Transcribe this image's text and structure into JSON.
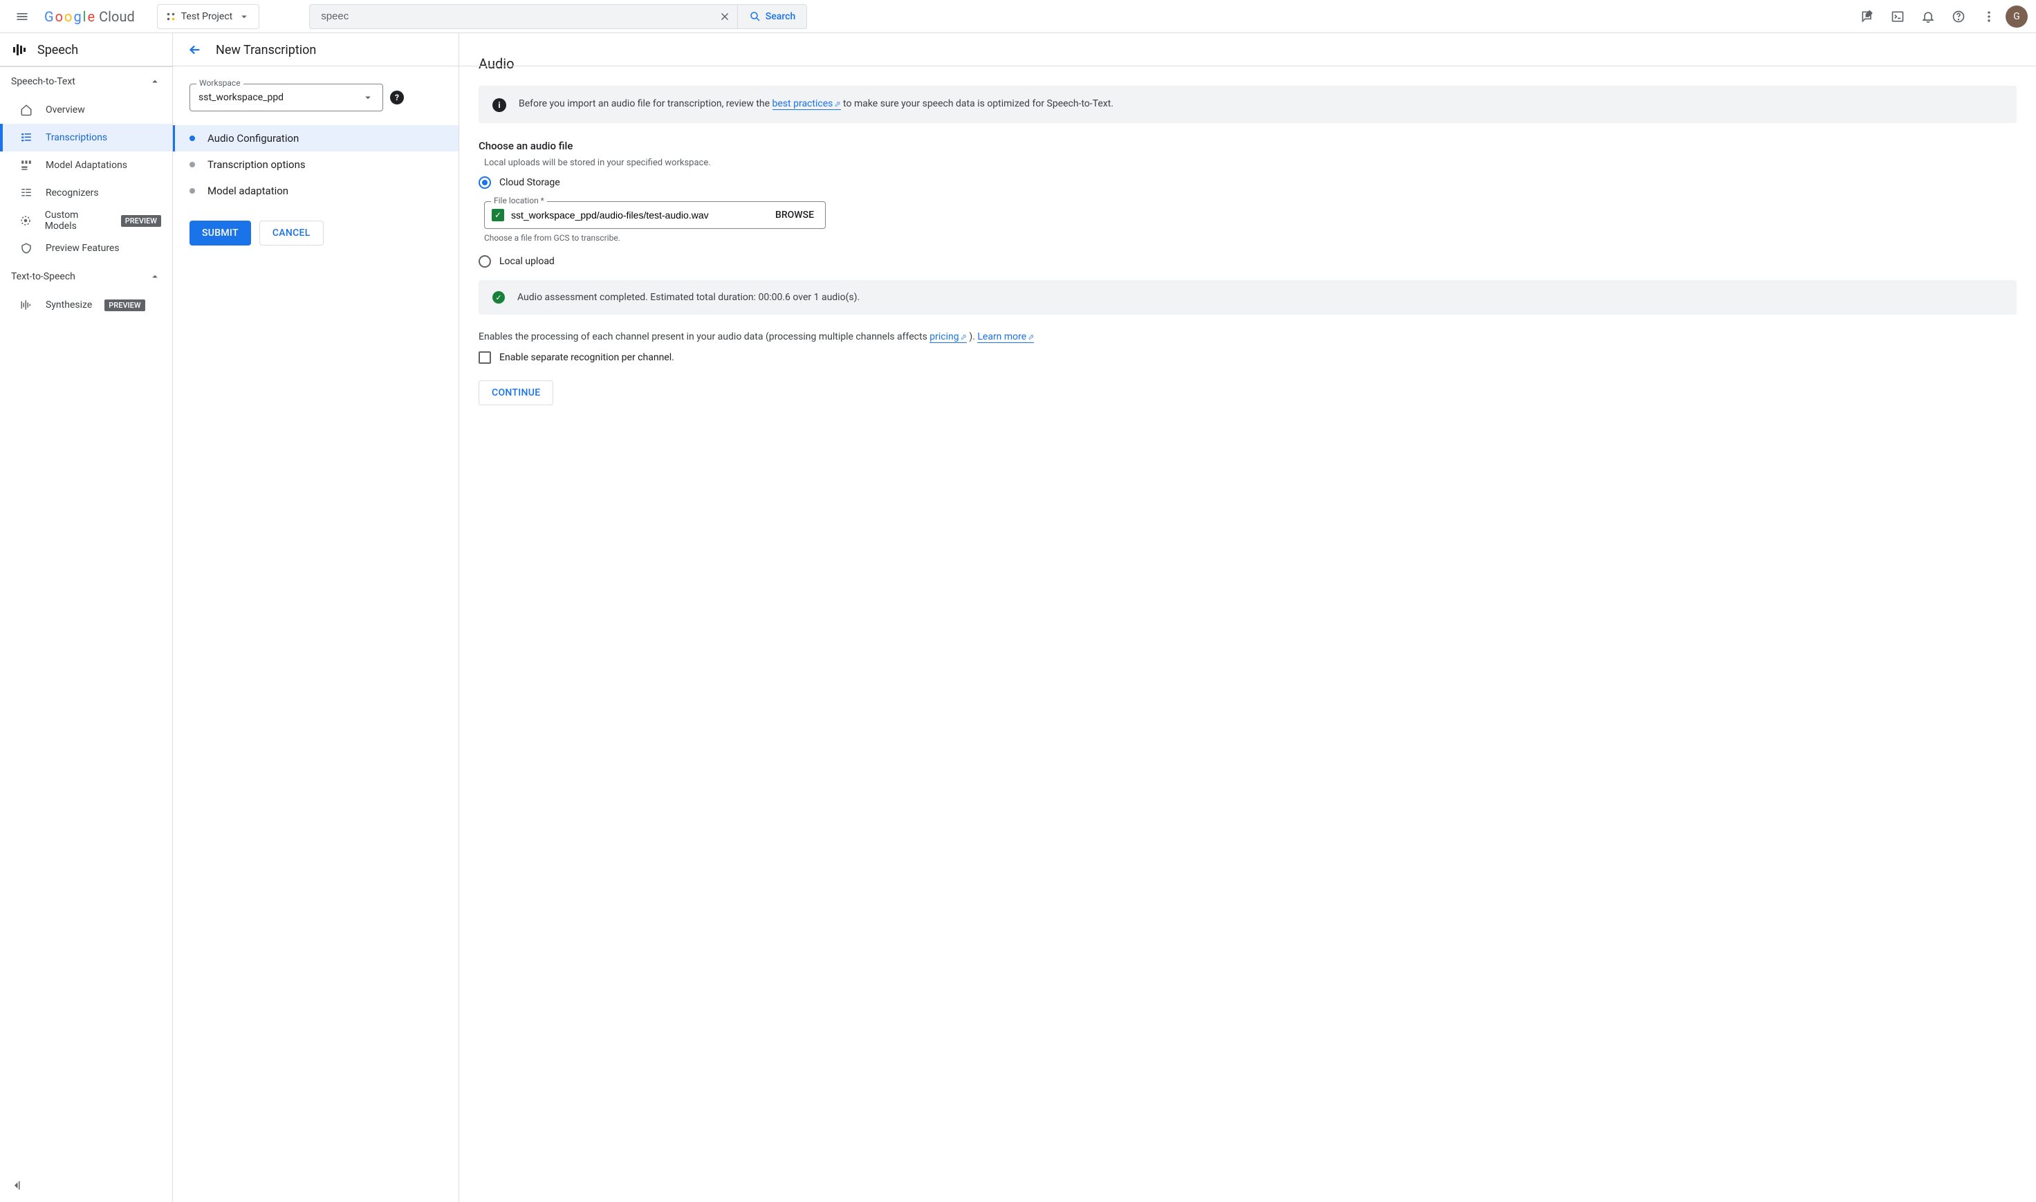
{
  "header": {
    "logo_text": "Google",
    "logo_suffix": "Cloud",
    "project_name": "Test Project",
    "search_value": "speec",
    "search_button": "Search",
    "avatar_initial": "G"
  },
  "sidebar": {
    "service_title": "Speech",
    "sections": [
      {
        "title": "Speech-to-Text",
        "items": [
          {
            "label": "Overview"
          },
          {
            "label": "Transcriptions",
            "active": true
          },
          {
            "label": "Model Adaptations"
          },
          {
            "label": "Recognizers"
          },
          {
            "label": "Custom Models",
            "badge": "PREVIEW"
          },
          {
            "label": "Preview Features"
          }
        ]
      },
      {
        "title": "Text-to-Speech",
        "items": [
          {
            "label": "Synthesize",
            "badge": "PREVIEW"
          }
        ]
      }
    ]
  },
  "mid": {
    "page_title": "New Transcription",
    "workspace_label": "Workspace",
    "workspace_value": "sst_workspace_ppd",
    "steps": [
      {
        "label": "Audio Configuration",
        "active": true
      },
      {
        "label": "Transcription options"
      },
      {
        "label": "Model adaptation"
      }
    ],
    "submit": "SUBMIT",
    "cancel": "CANCEL"
  },
  "content": {
    "section_title": "Audio",
    "banner_prefix": "Before you import an audio file for transcription, review the ",
    "banner_link": "best practices",
    "banner_suffix": " to make sure your speech data is optimized for Speech-to-Text.",
    "choose_hdr": "Choose an audio file",
    "upload_hint": "Local uploads will be stored in your specified workspace.",
    "radio_cloud": "Cloud Storage",
    "radio_local": "Local upload",
    "file_location_label": "File location *",
    "file_location_value": "sst_workspace_ppd/audio-files/test-audio.wav",
    "browse": "BROWSE",
    "file_hint": "Choose a file from GCS to transcribe.",
    "assessment": "Audio assessment completed. Estimated total duration: 00:00.6 over 1 audio(s).",
    "channel_text_1": "Enables the processing of each channel present in your audio data (processing multiple channels affects ",
    "pricing_link": "pricing",
    "channel_text_2": " ). ",
    "learn_more": "Learn more",
    "checkbox_label": "Enable separate recognition per channel.",
    "continue": "CONTINUE"
  }
}
